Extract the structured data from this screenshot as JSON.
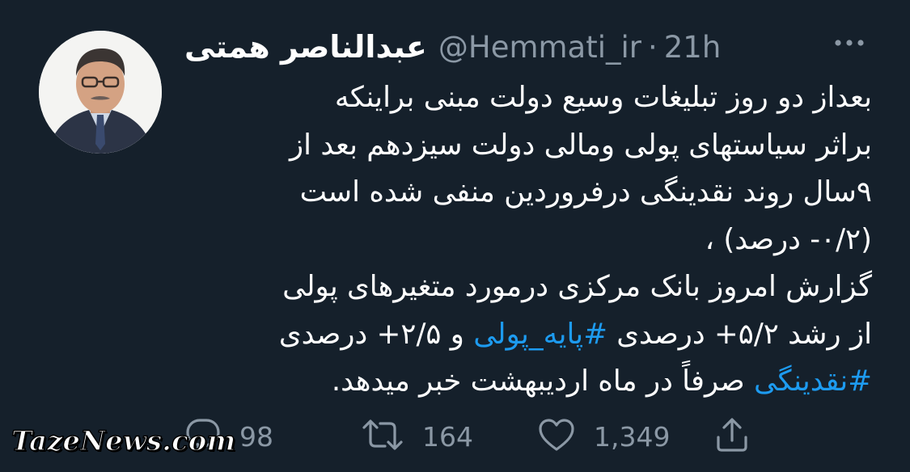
{
  "tweet": {
    "author": {
      "display_name": "عبدالناصر همتی",
      "handle": "@Hemmati_ir",
      "separator": "·",
      "time": "21h"
    },
    "body_lines": [
      "بعداز دو روز تبلیغات وسیع دولت مبنی براینکه",
      "براثر سیاستهای پولی ومالی دولت سیزدهم بعد از",
      "۹سال روند نقدینگی درفروردین منفی شده است",
      "(۰/۲- درصد) ،",
      "گزارش امروز بانک مرکزی درمورد متغیرهای پولی"
    ],
    "line6": {
      "part1": "از رشد ۵/۲+ درصدی ",
      "hashtag": "#پایه_پولی",
      "part2": " و ۲/۵+ درصدی"
    },
    "line7": {
      "hashtag": "#نقدینگی",
      "part": " صرفاً در ماه اردیبهشت خبر میدهد."
    },
    "actions": {
      "replies": "98",
      "retweets": "164",
      "likes": "1,349"
    }
  },
  "watermark": "TazeNews.com",
  "colors": {
    "background": "#15202b",
    "text": "#ffffff",
    "secondary": "#8b98a5",
    "hashtag": "#1d9bf0"
  },
  "icons": [
    "more-icon",
    "reply-icon",
    "retweet-icon",
    "like-icon",
    "share-icon"
  ]
}
